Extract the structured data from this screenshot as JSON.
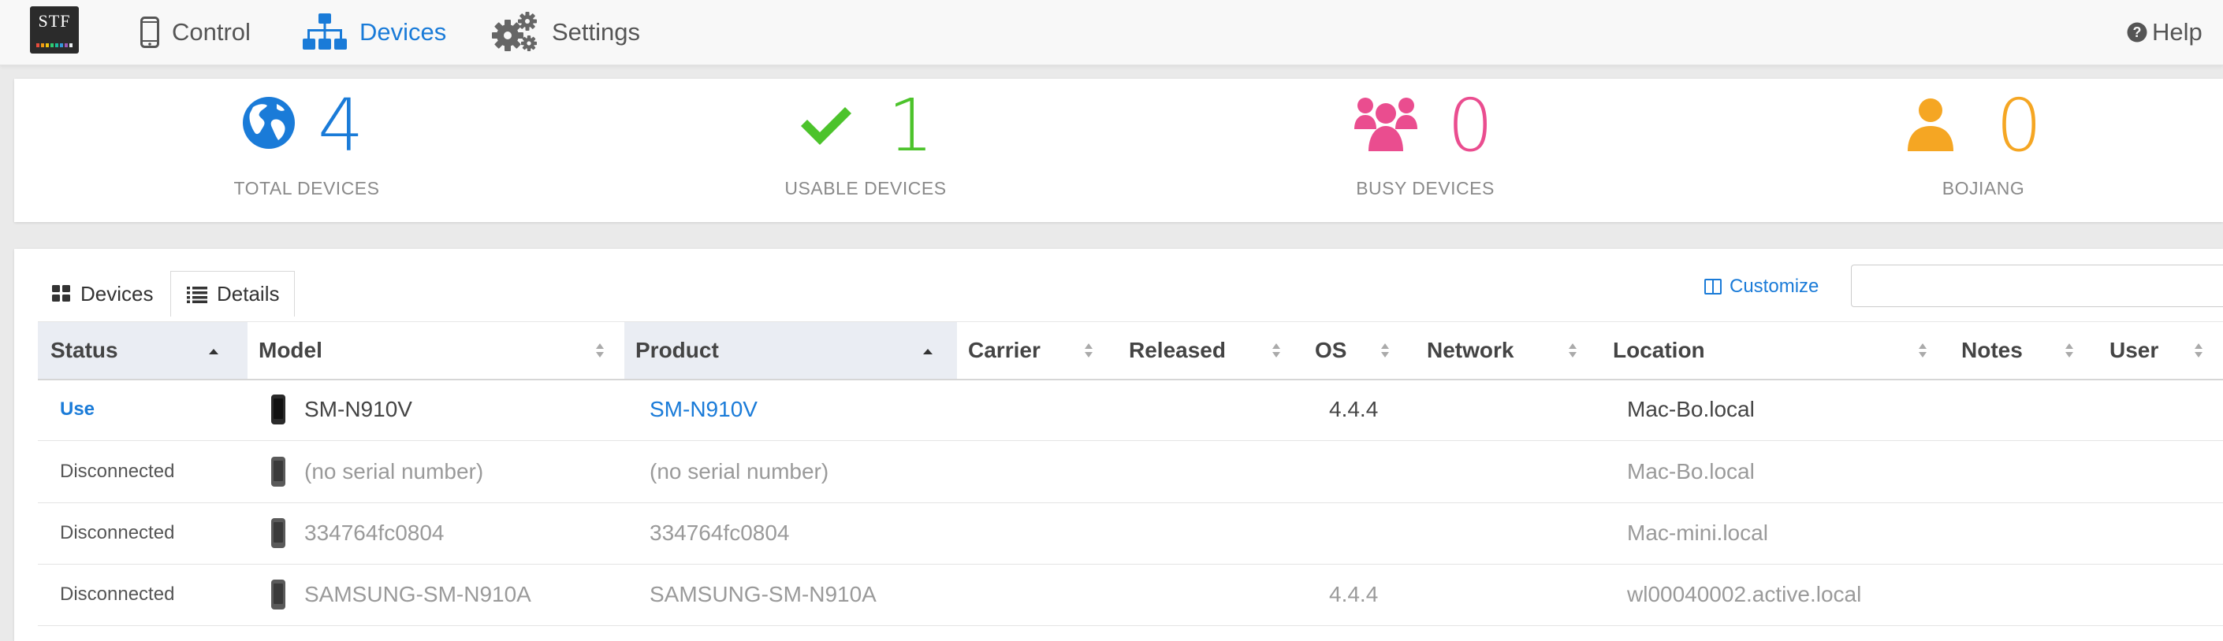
{
  "nav": {
    "logo_text": "STF",
    "items": [
      {
        "label": "Control",
        "icon": "phone-icon"
      },
      {
        "label": "Devices",
        "icon": "sitemap-icon"
      },
      {
        "label": "Settings",
        "icon": "gears-icon"
      }
    ],
    "help_label": "Help"
  },
  "stats": [
    {
      "value": "4",
      "caption": "TOTAL DEVICES",
      "icon": "globe-icon",
      "color": "#1a7bd8"
    },
    {
      "value": "1",
      "caption": "USABLE DEVICES",
      "icon": "check-icon",
      "color": "#4cc32b"
    },
    {
      "value": "0",
      "caption": "BUSY DEVICES",
      "icon": "users-icon",
      "color": "#ea4d8f"
    },
    {
      "value": "0",
      "caption": "BOJIANG",
      "icon": "user-icon",
      "color": "#f5a623"
    }
  ],
  "tabs": [
    {
      "label": "Devices",
      "icon": "grid-icon"
    },
    {
      "label": "Details",
      "icon": "list-icon"
    }
  ],
  "customize_label": "Customize",
  "search": {
    "placeholder": "",
    "value": ""
  },
  "table": {
    "columns": [
      "Status",
      "Model",
      "Product",
      "Carrier",
      "Released",
      "OS",
      "Network",
      "Location",
      "Notes",
      "User"
    ],
    "rows": [
      {
        "status": "Use",
        "model": "SM-N910V",
        "product": "SM-N910V",
        "os": "4.4.4",
        "location": "Mac-Bo.local"
      },
      {
        "status": "Disconnected",
        "model": "(no serial number)",
        "product": "(no serial number)",
        "os": "",
        "location": "Mac-Bo.local"
      },
      {
        "status": "Disconnected",
        "model": "334764fc0804",
        "product": "334764fc0804",
        "os": "",
        "location": "Mac-mini.local"
      },
      {
        "status": "Disconnected",
        "model": "SAMSUNG-SM-N910A",
        "product": "SAMSUNG-SM-N910A",
        "os": "4.4.4",
        "location": "wl00040002.active.local"
      }
    ]
  },
  "colors": {
    "accent": "#1a7bd8",
    "usable": "#4cc32b",
    "busy": "#ea4d8f",
    "user": "#f5a623"
  }
}
